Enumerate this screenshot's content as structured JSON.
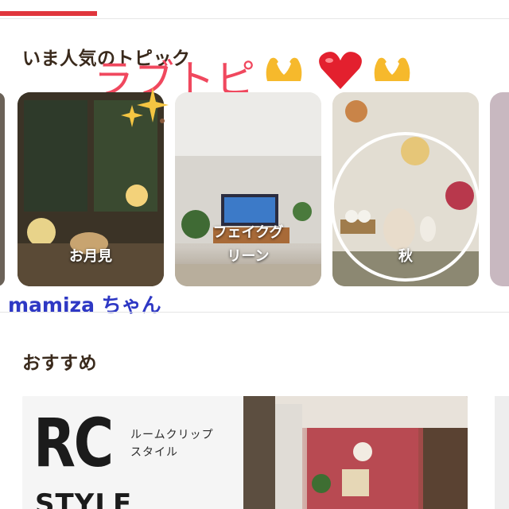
{
  "header": {
    "progress": 0.19
  },
  "sections": {
    "topics_title": "いま人気のトピック",
    "recommended_title": "おすすめ"
  },
  "overlay": {
    "love_topic": "ラブトピ",
    "signature": "mamiza ちゃん"
  },
  "topics": [
    {
      "label": "お月見"
    },
    {
      "label": "フェイクグ\nリーン"
    },
    {
      "label": "秋"
    }
  ],
  "promo": {
    "logo_big": "RC",
    "logo_small": "STYLE",
    "subtitle_line1": "ルームクリップ",
    "subtitle_line2": "スタイル"
  },
  "colors": {
    "accent": "#e0353c",
    "overlay_pink": "#f0485e",
    "signature_blue": "#2e38c4"
  },
  "icons": [
    "heart-hands-emoji",
    "red-heart-emoji",
    "sparkles-emoji"
  ]
}
